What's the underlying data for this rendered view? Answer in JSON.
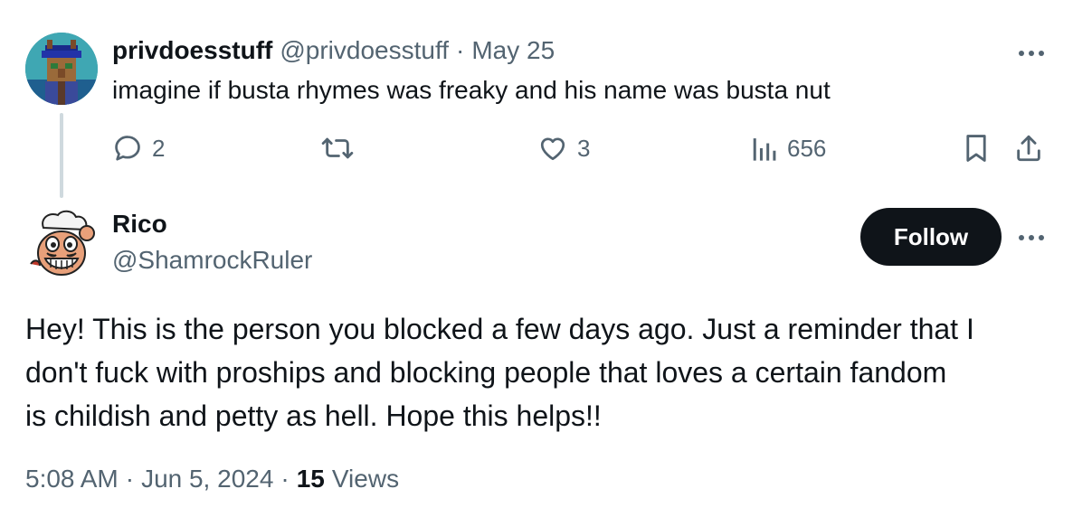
{
  "parent_tweet": {
    "display_name": "privdoesstuff",
    "handle": "@privdoesstuff",
    "separator": "·",
    "date": "May 25",
    "text": "imagine if busta rhymes was freaky and his name was busta nut",
    "more_icon": "more-horizontal-icon",
    "actions": {
      "reply_count": "2",
      "retweet_count": "",
      "like_count": "3",
      "views_count": "656"
    }
  },
  "main_tweet": {
    "display_name": "Rico",
    "handle": "@ShamrockRuler",
    "follow_label": "Follow",
    "body_lines": [
      "Hey! This is the person you blocked a few days ago. Just a reminder that I",
      "don't fuck with proships and blocking people that loves a certain fandom",
      "is childish and petty as hell. Hope this helps!!"
    ],
    "time": "5:08 AM",
    "separator": "·",
    "date": "Jun 5, 2024",
    "views_count": "15",
    "views_label": "Views"
  },
  "colors": {
    "text_primary": "#0f1419",
    "text_secondary": "#536471",
    "thread_line": "#cfd9de",
    "follow_button_bg": "#0f1419",
    "follow_button_text": "#ffffff",
    "background": "#ffffff"
  }
}
